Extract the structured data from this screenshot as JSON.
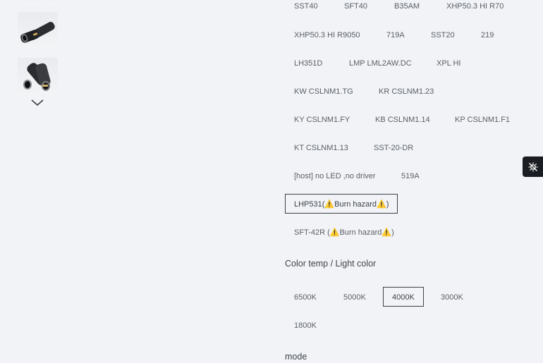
{
  "led_options": [
    {
      "label": "SST40"
    },
    {
      "label": "SFT40"
    },
    {
      "label": "B35AM"
    },
    {
      "label": "XHP50.3 HI R70"
    },
    {
      "label": "XHP50.3 HI R9050"
    },
    {
      "label": "719A"
    },
    {
      "label": "SST20"
    },
    {
      "label": "219"
    },
    {
      "label": "LH351D"
    },
    {
      "label": "LMP LML2AW.DC"
    },
    {
      "label": "XPL HI"
    },
    {
      "label": "KW CSLNM1.TG"
    },
    {
      "label": "KR CSLNM1.23"
    },
    {
      "label": "KY CSLNM1.FY"
    },
    {
      "label": "KB CSLNM1.14"
    },
    {
      "label": "KP CSLNM1.F1"
    },
    {
      "label": "KT CSLNM1.13"
    },
    {
      "label": "SST-20-DR"
    },
    {
      "label": "[host] no LED ,no driver"
    },
    {
      "label": "519A"
    },
    {
      "label_pre": "LHP531(",
      "warn": "⚠️",
      "label_mid": "Burn hazard",
      "label_post": ")",
      "selected": true
    },
    {
      "label_pre": "SFT-42R (",
      "warn": "⚠️",
      "label_mid": "Burn hazard",
      "label_post": ")"
    }
  ],
  "color_temp": {
    "label": "Color temp / Light color",
    "options": [
      {
        "label": "6500K"
      },
      {
        "label": "5000K"
      },
      {
        "label": "4000K",
        "selected": true
      },
      {
        "label": "3000K"
      },
      {
        "label": "1800K"
      }
    ]
  },
  "mode": {
    "label": "mode"
  },
  "float_button": {
    "icon": "accessibility-icon"
  }
}
